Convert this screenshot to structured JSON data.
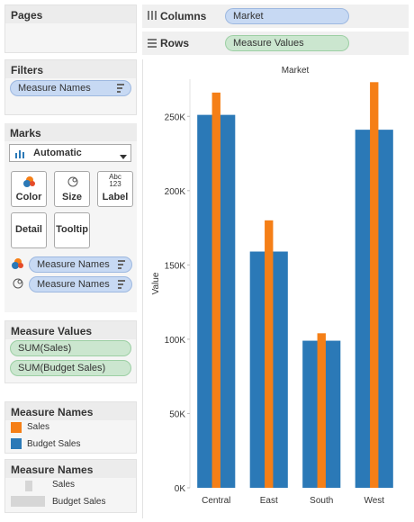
{
  "pages": {
    "title": "Pages"
  },
  "shelves": {
    "columns_label": "Columns",
    "columns_pill": "Market",
    "rows_label": "Rows",
    "rows_pill": "Measure Values"
  },
  "filters": {
    "title": "Filters",
    "pill": "Measure Names"
  },
  "marks": {
    "title": "Marks",
    "type": "Automatic",
    "buttons": {
      "color": "Color",
      "size": "Size",
      "label": "Label",
      "label_icon": "Abc\n123",
      "detail": "Detail",
      "tooltip": "Tooltip"
    },
    "color_pill": "Measure Names",
    "size_pill": "Measure Names"
  },
  "measure_values": {
    "title": "Measure Values",
    "items": [
      "SUM(Sales)",
      "SUM(Budget Sales)"
    ]
  },
  "color_legend": {
    "title": "Measure Names",
    "items": [
      {
        "label": "Sales",
        "color": "#f57f17"
      },
      {
        "label": "Budget Sales",
        "color": "#2b79b7"
      }
    ]
  },
  "size_legend": {
    "title": "Measure Names",
    "items": [
      {
        "label": "Sales"
      },
      {
        "label": "Budget Sales"
      }
    ]
  },
  "chart_data": {
    "type": "bar",
    "title": "Market",
    "ylabel": "Value",
    "categories": [
      "Central",
      "East",
      "South",
      "West"
    ],
    "series": [
      {
        "name": "Budget Sales",
        "color": "#2b79b7",
        "values": [
          251000,
          159000,
          99000,
          241000
        ]
      },
      {
        "name": "Sales",
        "color": "#f57f17",
        "values": [
          266000,
          180000,
          104000,
          273000
        ]
      }
    ],
    "ylim": [
      0,
      275000
    ],
    "yticks": [
      0,
      50000,
      100000,
      150000,
      200000,
      250000
    ],
    "ytick_labels": [
      "0K",
      "50K",
      "100K",
      "150K",
      "200K",
      "250K"
    ]
  }
}
